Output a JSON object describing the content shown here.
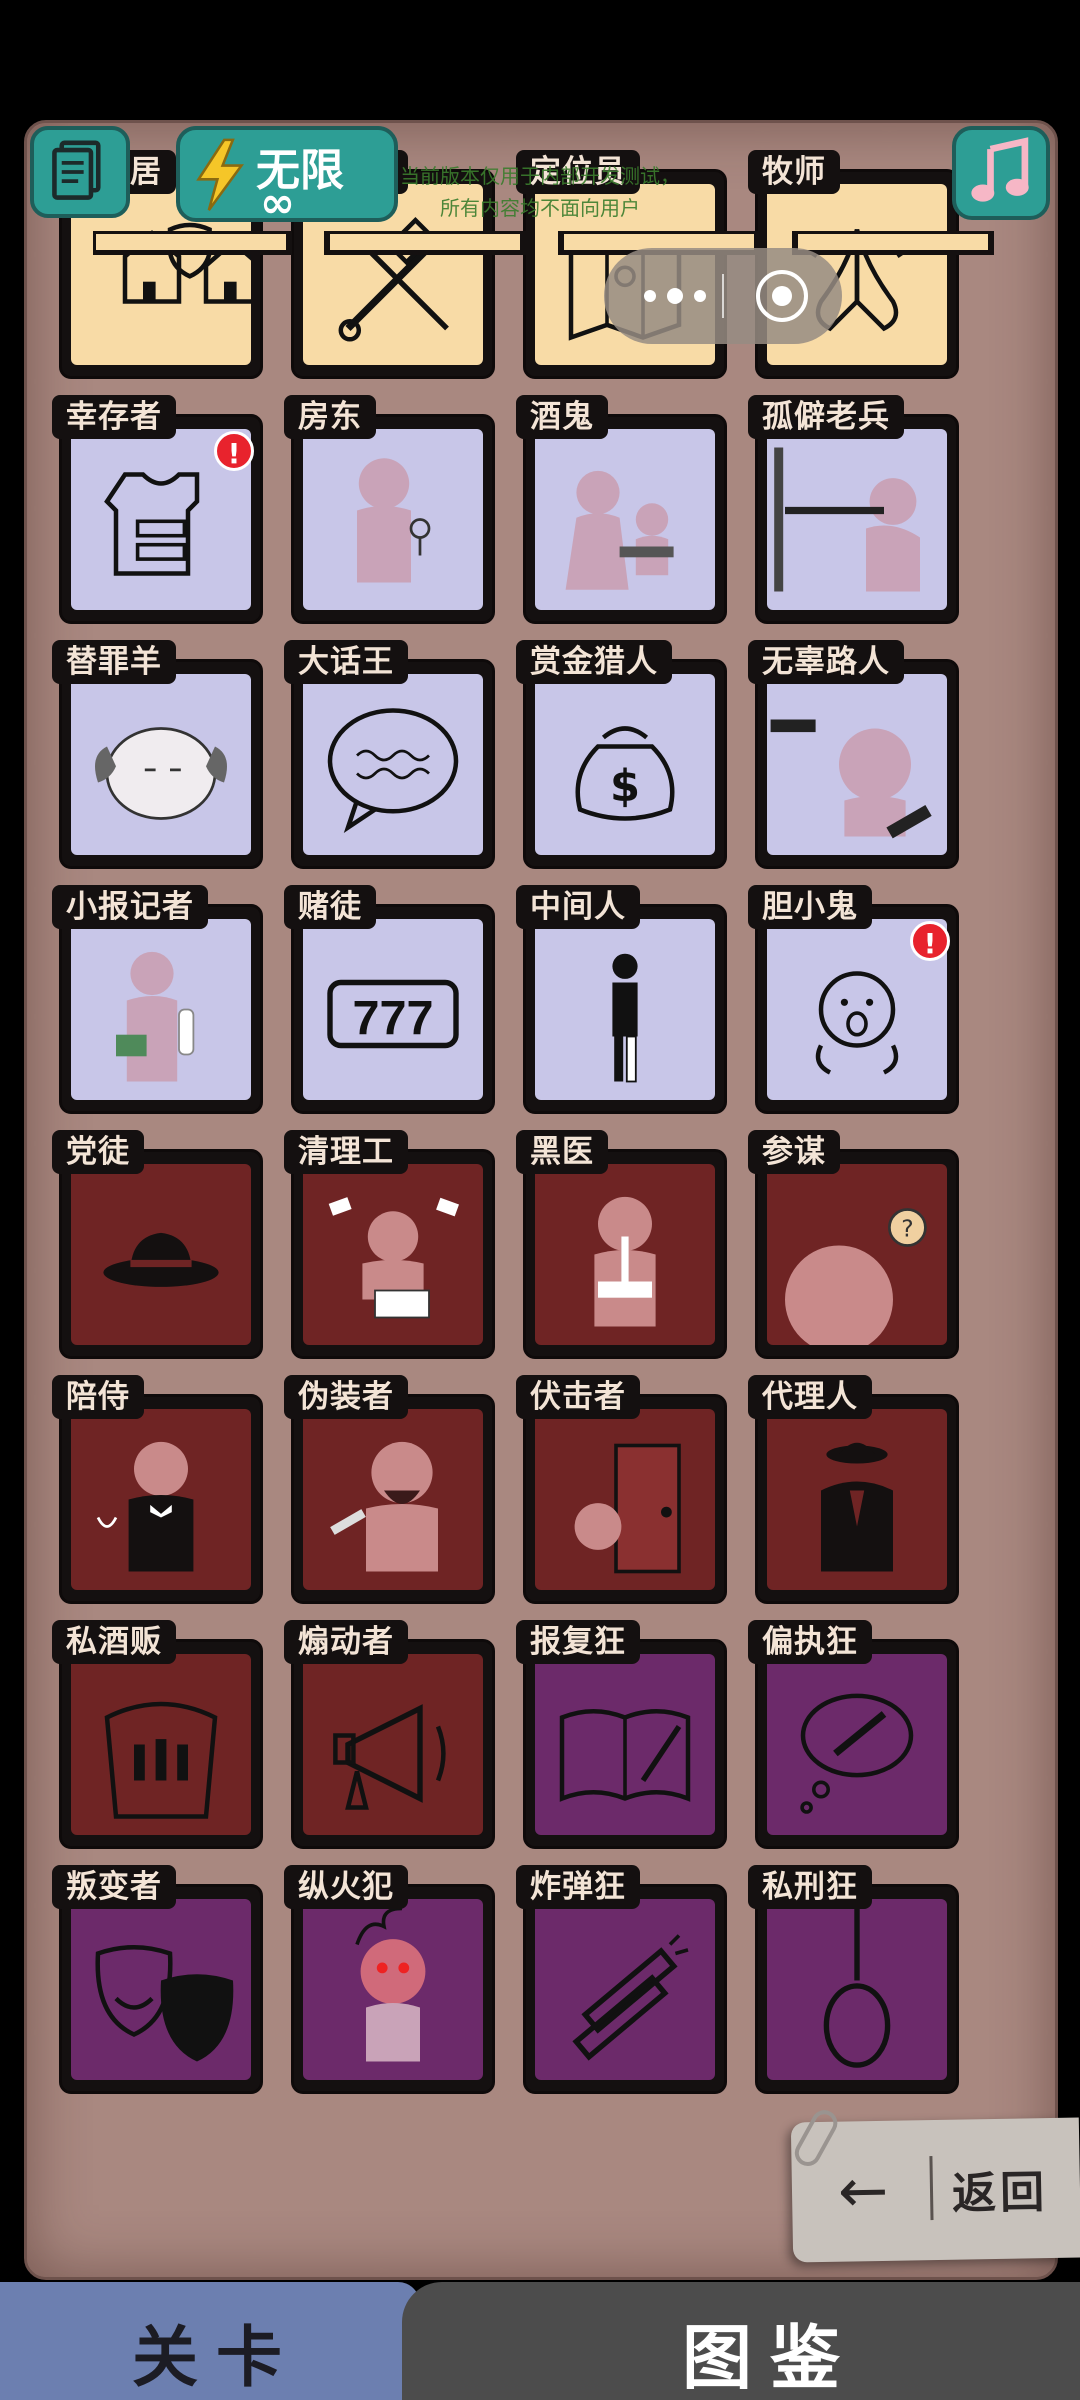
{
  "top_bar": {
    "energy_label": "无限",
    "energy_sub": "∞",
    "notice_line1": "当前版本仅用于内部开发测试，",
    "notice_line2": "所有内容均不面向用户"
  },
  "cards": [
    {
      "label": "好邻居",
      "theme": "town",
      "icon": "neighborhood-houses-shield-icon"
    },
    {
      "label": "执法长",
      "theme": "town",
      "icon": "gavel-sword-icon"
    },
    {
      "label": "定位员",
      "theme": "town",
      "icon": "map-location-icon"
    },
    {
      "label": "牧师",
      "theme": "town",
      "icon": "praying-hands-icon"
    },
    {
      "label": "幸存者",
      "theme": "out",
      "icon": "bulletproof-vest-icon",
      "badge": "!"
    },
    {
      "label": "房东",
      "theme": "out",
      "icon": "landlord-keys-icon"
    },
    {
      "label": "酒鬼",
      "theme": "out",
      "icon": "drunkard-icon"
    },
    {
      "label": "孤僻老兵",
      "theme": "out",
      "icon": "veteran-rifle-icon"
    },
    {
      "label": "替罪羊",
      "theme": "out",
      "icon": "sheep-icon"
    },
    {
      "label": "大话王",
      "theme": "out",
      "icon": "speech-bubble-scribble-icon"
    },
    {
      "label": "赏金猎人",
      "theme": "out",
      "icon": "money-bag-icon"
    },
    {
      "label": "无辜路人",
      "theme": "out",
      "icon": "bystander-guns-icon"
    },
    {
      "label": "小报记者",
      "theme": "out",
      "icon": "reporter-icon"
    },
    {
      "label": "赌徒",
      "theme": "out",
      "icon": "slot-777-icon"
    },
    {
      "label": "中间人",
      "theme": "out",
      "icon": "half-person-icon"
    },
    {
      "label": "胆小鬼",
      "theme": "out",
      "icon": "scared-face-icon",
      "badge": "!"
    },
    {
      "label": "党徒",
      "theme": "mafia",
      "icon": "fedora-hat-icon"
    },
    {
      "label": "清理工",
      "theme": "mafia",
      "icon": "cleaner-icon"
    },
    {
      "label": "黑医",
      "theme": "mafia",
      "icon": "bandaged-doctor-icon"
    },
    {
      "label": "参谋",
      "theme": "mafia",
      "icon": "advisor-lightbulb-icon"
    },
    {
      "label": "陪侍",
      "theme": "mafia",
      "icon": "waiter-wine-icon"
    },
    {
      "label": "伪装者",
      "theme": "mafia",
      "icon": "disguiser-icon"
    },
    {
      "label": "伏击者",
      "theme": "mafia",
      "icon": "door-ambusher-icon"
    },
    {
      "label": "代理人",
      "theme": "mafia",
      "icon": "suit-agent-icon"
    },
    {
      "label": "私酒贩",
      "theme": "mafia",
      "icon": "bottles-coat-icon"
    },
    {
      "label": "煽动者",
      "theme": "mafia",
      "icon": "megaphone-icon"
    },
    {
      "label": "报复狂",
      "theme": "evil",
      "icon": "book-knife-icon"
    },
    {
      "label": "偏执狂",
      "theme": "evil",
      "icon": "thought-knife-icon"
    },
    {
      "label": "叛变者",
      "theme": "evil",
      "icon": "theater-masks-icon"
    },
    {
      "label": "纵火犯",
      "theme": "evil",
      "icon": "arsonist-fire-icon"
    },
    {
      "label": "炸弹狂",
      "theme": "evil",
      "icon": "dynamite-icon"
    },
    {
      "label": "私刑狂",
      "theme": "evil",
      "icon": "noose-icon"
    }
  ],
  "back_button": {
    "label": "返回"
  },
  "bottom_tabs": {
    "level": "关卡",
    "guide": "图鉴"
  },
  "colors": {
    "town": "#f8dba6",
    "outsider": "#c8c6e8",
    "mafia": "#6f2424",
    "evil": "#6c2a6a",
    "teal": "#2d9e95"
  }
}
